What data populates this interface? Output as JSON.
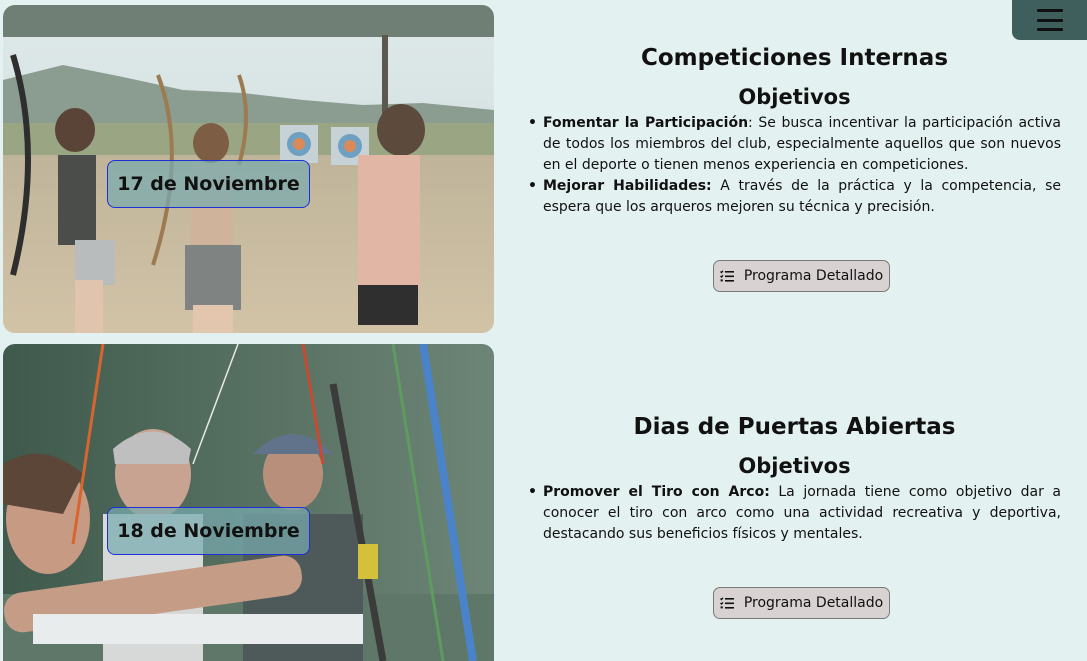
{
  "menu": {
    "icon": "hamburger-menu-icon"
  },
  "events": [
    {
      "date": "17 de Noviembre",
      "title": "Competiciones Internas",
      "objectives_heading": "Objetivos",
      "objectives": [
        {
          "label": "Fomentar la Participación",
          "sep": ":",
          "text": " Se busca incentivar la participación activa de todos los miembros del club, especialmente aquellos que son nuevos en el deporte o tienen menos experiencia en competiciones."
        },
        {
          "label": "Mejorar Habilidades:",
          "sep": "",
          "text": " A través de la práctica y la competencia, se espera que los arqueros mejoren su técnica y precisión."
        }
      ],
      "button_label": "Programa Detallado",
      "button_icon": "checklist-icon"
    },
    {
      "date": "18 de Noviembre",
      "title": "Dias de Puertas Abiertas",
      "objectives_heading": "Objetivos",
      "objectives": [
        {
          "label": "Promover el Tiro con Arco:",
          "sep": "",
          "text": " La jornada tiene como objetivo dar a conocer el tiro con arco como una actividad recreativa y deportiva, destacando sus beneficios físicos y mentales."
        }
      ],
      "button_label": "Programa Detallado",
      "button_icon": "checklist-icon"
    }
  ],
  "colors": {
    "background": "#e3f2f1",
    "menu_bg": "#3f5f5d",
    "badge_border": "#1e2fd6",
    "button_bg": "#d8d2d2"
  }
}
